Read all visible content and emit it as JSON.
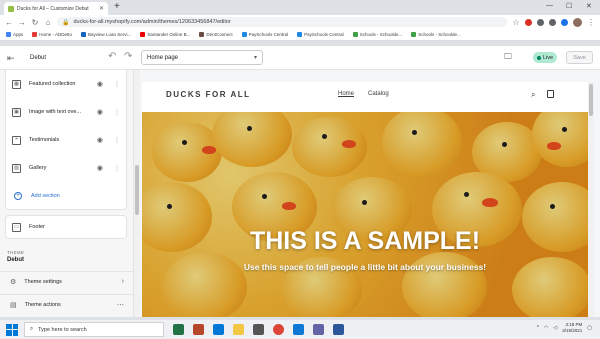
{
  "browser": {
    "tab_title": "Ducks for All – Customize Debut",
    "new_tab_glyph": "+",
    "url": "ducks-for-all.myshopify.com/admin/themes/120633456847/editor",
    "bookmarks": [
      {
        "label": "Apps",
        "color": "#4285f4"
      },
      {
        "label": "Home - ADDetto",
        "color": "#e53935"
      },
      {
        "label": "Bayview Loan Servi...",
        "color": "#1565c0"
      },
      {
        "label": "Santander Online B...",
        "color": "#ec0000"
      },
      {
        "label": "DentConnect",
        "color": "#6d4c41"
      },
      {
        "label": "PaySchools Central",
        "color": "#1e88e5"
      },
      {
        "label": "PaySchools Central",
        "color": "#1e88e5"
      },
      {
        "label": "Schools - Schoolde...",
        "color": "#43a047"
      },
      {
        "label": "Schools - Schoolde...",
        "color": "#43a047"
      }
    ]
  },
  "editor": {
    "theme_name": "Debut",
    "page_selector": "Home page",
    "status_badge": "Live",
    "save_label": "Save"
  },
  "sidebar": {
    "sections": [
      {
        "label": "Featured collection",
        "icon": "grid-icon"
      },
      {
        "label": "Image with text ove...",
        "icon": "image-text-icon"
      },
      {
        "label": "Testimonials",
        "icon": "quote-icon"
      },
      {
        "label": "Gallery",
        "icon": "image-icon"
      }
    ],
    "add_section": "Add section",
    "footer": "Footer",
    "theme_heading": "THEME",
    "theme_value": "Debut",
    "theme_settings": "Theme settings",
    "theme_actions": "Theme actions"
  },
  "storefront": {
    "brand": "DUCKS FOR ALL",
    "menu": [
      "Home",
      "Catalog"
    ],
    "hero_title": "THIS IS A SAMPLE!",
    "hero_subtitle": "Use this space to tell people a little bit about your business!"
  },
  "taskbar": {
    "search_placeholder": "Type here to search",
    "time": "3:18 PM",
    "date": "3/19/2021"
  },
  "colors": {
    "live_badge": "#aee9d1",
    "link": "#2c6ecb",
    "hero": "#f7b733"
  }
}
